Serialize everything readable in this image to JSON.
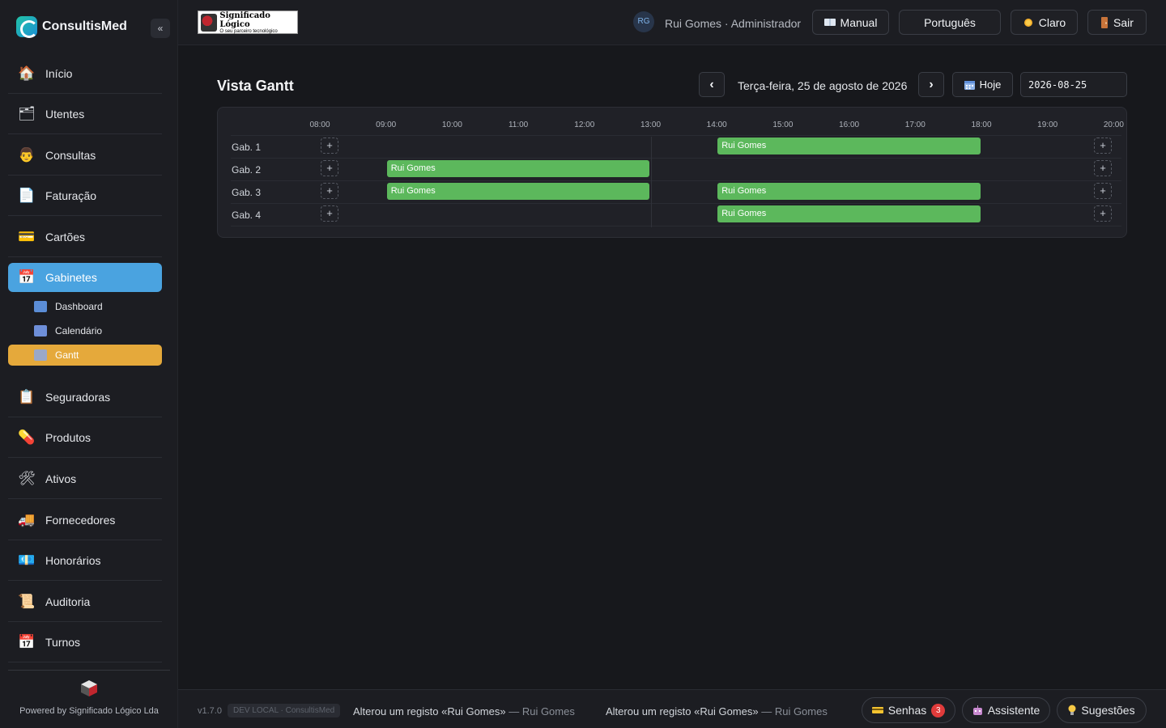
{
  "app": {
    "name": "ConsultisMed",
    "collapse_symbol": "«"
  },
  "sidebar": {
    "items": [
      {
        "label": "Início",
        "icon": "house-icon"
      },
      {
        "label": "Utentes",
        "icon": "patients-icon"
      },
      {
        "label": "Consultas",
        "icon": "doctor-icon"
      },
      {
        "label": "Faturação",
        "icon": "invoice-icon"
      },
      {
        "label": "Cartões",
        "icon": "card-icon"
      },
      {
        "label": "Gabinetes",
        "icon": "calendar-icon"
      },
      {
        "label": "Seguradoras",
        "icon": "insurance-icon"
      },
      {
        "label": "Produtos",
        "icon": "pill-icon"
      },
      {
        "label": "Ativos",
        "icon": "tools-icon"
      },
      {
        "label": "Fornecedores",
        "icon": "truck-icon"
      },
      {
        "label": "Honorários",
        "icon": "money-icon"
      },
      {
        "label": "Auditoria",
        "icon": "scroll-icon"
      },
      {
        "label": "Turnos",
        "icon": "calendar-icon"
      }
    ],
    "active": "Gabinetes",
    "subitems": [
      {
        "label": "Dashboard",
        "icon": "bar-chart-icon"
      },
      {
        "label": "Calendário",
        "icon": "calendar-icon"
      },
      {
        "label": "Gantt",
        "icon": "chart-icon"
      }
    ],
    "active_sub": "Gantt",
    "powered_by": "Powered by Significado Lógico Lda"
  },
  "header": {
    "company_logo_title": "Significado Lógico",
    "company_logo_tagline": "O seu parceiro tecnológico",
    "user_initials": "RG",
    "user_label": "Rui Gomes · Administrador",
    "manual_label": "Manual",
    "language_label": "Português",
    "theme_label": "Claro",
    "logout_label": "Sair"
  },
  "main": {
    "title": "Vista Gantt",
    "prev_symbol": "‹",
    "next_symbol": "›",
    "date_label": "Terça-feira, 25 de agosto de 2026",
    "today_label": "Hoje",
    "date_value": "2026-08-25"
  },
  "gantt": {
    "hours": [
      "08:00",
      "09:00",
      "10:00",
      "11:00",
      "12:00",
      "13:00",
      "14:00",
      "15:00",
      "16:00",
      "17:00",
      "18:00",
      "19:00",
      "20:00"
    ],
    "add_symbol": "+",
    "rows": [
      {
        "label": "Gab. 1",
        "bookings": [
          {
            "name": "Rui Gomes",
            "start": "14:00",
            "end": "18:00"
          }
        ]
      },
      {
        "label": "Gab. 2",
        "bookings": [
          {
            "name": "Rui Gomes",
            "start": "09:00",
            "end": "13:00"
          }
        ]
      },
      {
        "label": "Gab. 3",
        "bookings": [
          {
            "name": "Rui Gomes",
            "start": "09:00",
            "end": "13:00"
          },
          {
            "name": "Rui Gomes",
            "start": "14:00",
            "end": "18:00"
          }
        ]
      },
      {
        "label": "Gab. 4",
        "bookings": [
          {
            "name": "Rui Gomes",
            "start": "14:00",
            "end": "18:00"
          }
        ]
      }
    ],
    "bar_color": "#5cb85c"
  },
  "footer": {
    "version": "v1.7.0",
    "env": "DEV LOCAL · ConsultisMed",
    "activity": [
      {
        "text": "Alterou um registo «Rui Gomes»",
        "who": "— Rui Gomes"
      },
      {
        "text": "Alterou um registo «Rui Gomes»",
        "who": "— Rui Gomes"
      }
    ],
    "tickets_label": "Senhas",
    "tickets_count": "3",
    "assistant_label": "Assistente",
    "suggestions_label": "Sugestões"
  },
  "colors": {
    "accent_blue": "#4aa3e0",
    "accent_orange": "#e5a93b",
    "badge_red": "#e03b3b"
  }
}
